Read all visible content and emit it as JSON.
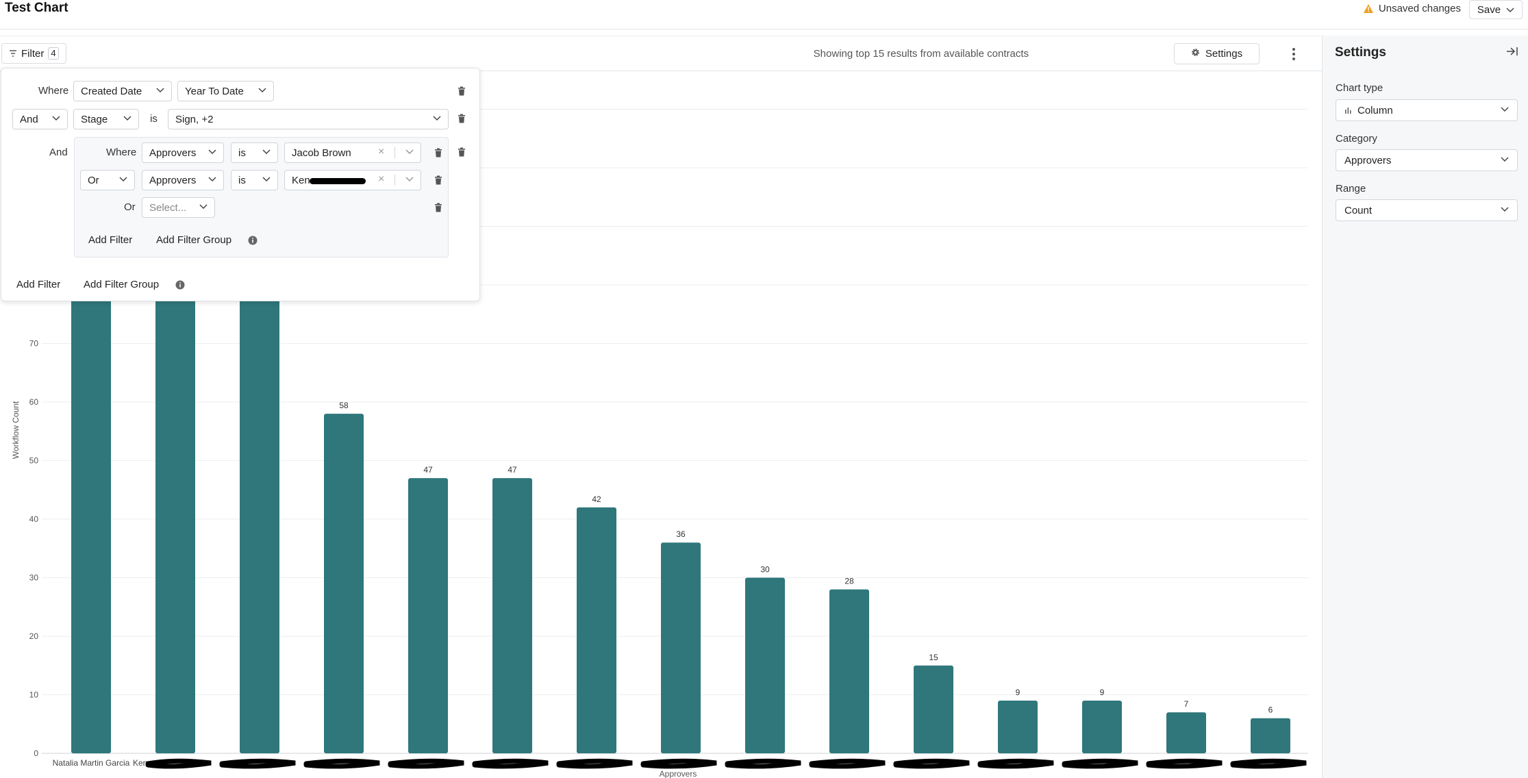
{
  "header": {
    "title": "Test Chart",
    "unsaved_label": "Unsaved changes",
    "save_label": "Save"
  },
  "toolbar": {
    "filter_label": "Filter",
    "filter_count": "4",
    "showing_text": "Showing top 15 results from available contracts",
    "settings_label": "Settings"
  },
  "filters": {
    "row1": {
      "where": "Where",
      "field": "Created Date",
      "value": "Year To Date"
    },
    "row2": {
      "conjunction": "And",
      "field": "Stage",
      "op": "is",
      "value": "Sign, +2"
    },
    "group": {
      "conjunction": "And",
      "row1": {
        "where": "Where",
        "field": "Approvers",
        "op": "is",
        "value": "Jacob Brown"
      },
      "row2": {
        "conjunction": "Or",
        "field": "Approvers",
        "op": "is",
        "value": "Ken"
      },
      "row3": {
        "conjunction": "Or",
        "placeholder": "Select..."
      },
      "add_filter": "Add Filter",
      "add_group": "Add Filter Group"
    },
    "add_filter": "Add Filter",
    "add_group": "Add Filter Group"
  },
  "settings_panel": {
    "title": "Settings",
    "chart_type_label": "Chart type",
    "chart_type_value": "Column",
    "category_label": "Category",
    "category_value": "Approvers",
    "range_label": "Range",
    "range_value": "Count"
  },
  "colors": {
    "bar": "#2f777b",
    "accent_warning": "#f0a020"
  },
  "chart_data": {
    "type": "bar",
    "categories": [
      "Natalia Martin Garcia",
      "Ken",
      "",
      "",
      "",
      "",
      "",
      "",
      "",
      "",
      "",
      "",
      "",
      "",
      ""
    ],
    "redacted": [
      false,
      true,
      true,
      true,
      true,
      true,
      true,
      true,
      true,
      true,
      true,
      true,
      true,
      true,
      true
    ],
    "values": [
      null,
      null,
      null,
      58,
      47,
      47,
      42,
      36,
      30,
      28,
      15,
      9,
      9,
      7,
      6
    ],
    "labels": [
      "",
      "",
      "",
      "58",
      "47",
      "47",
      "42",
      "36",
      "30",
      "28",
      "15",
      "9",
      "9",
      "7",
      "6"
    ],
    "xlabel": "Approvers",
    "ylabel": "Workflow Count",
    "yticks": [
      0,
      10,
      20,
      30,
      40,
      50,
      60,
      70
    ],
    "ylim": [
      0,
      110
    ],
    "grid": true
  }
}
